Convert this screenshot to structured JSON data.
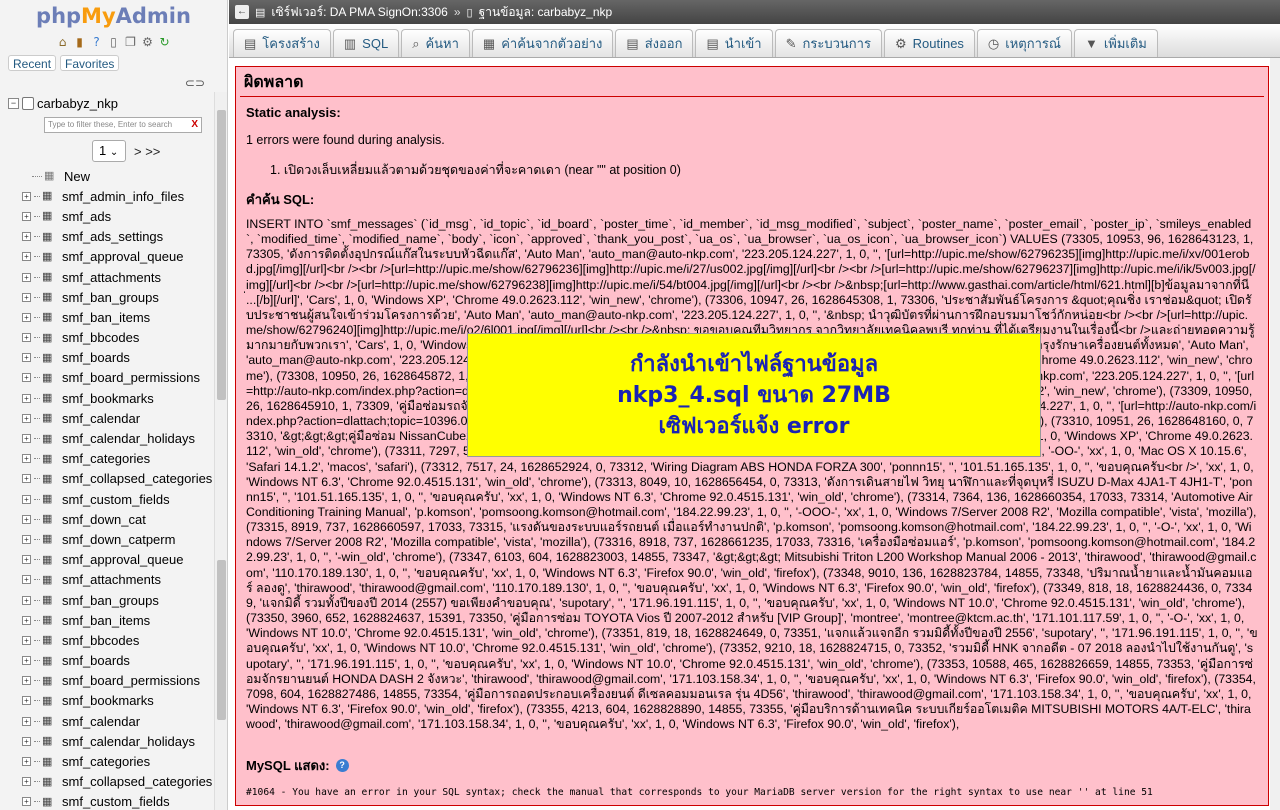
{
  "logo": {
    "part1": "php",
    "part2": "My",
    "part3": "Admin"
  },
  "quick_icons": [
    "home-icon",
    "exit-icon",
    "help-icon",
    "docs-icon",
    "copy-icon",
    "settings-icon",
    "reload-icon"
  ],
  "nav_tabs": {
    "recent": "Recent",
    "favorites": "Favorites"
  },
  "tree": {
    "database": "carbabyz_nkp",
    "filter_placeholder": "Type to filter these, Enter to search",
    "filter_clear": "X",
    "page_select_value": "1",
    "page_next": "> >>",
    "new_label": "New",
    "tables": [
      "smf_admin_info_files",
      "smf_ads",
      "smf_ads_settings",
      "smf_approval_queue",
      "smf_attachments",
      "smf_ban_groups",
      "smf_ban_items",
      "smf_bbcodes",
      "smf_boards",
      "smf_board_permissions",
      "smf_bookmarks",
      "smf_calendar",
      "smf_calendar_holidays",
      "smf_categories",
      "smf_collapsed_categories",
      "smf_custom_fields",
      "smf_down_cat",
      "smf_down_catperm",
      "smf_approval_queue",
      "smf_attachments",
      "smf_ban_groups",
      "smf_ban_items",
      "smf_bbcodes",
      "smf_boards",
      "smf_board_permissions",
      "smf_bookmarks",
      "smf_calendar",
      "smf_calendar_holidays",
      "smf_categories",
      "smf_collapsed_categories",
      "smf_custom_fields"
    ]
  },
  "breadcrumb": {
    "server": "เซิร์ฟเวอร์: DA PMA SignOn:3306",
    "separator": "»",
    "database": "ฐานข้อมูล: carbabyz_nkp"
  },
  "menu": [
    {
      "label": "โครงสร้าง",
      "icon": "structure-icon"
    },
    {
      "label": "SQL",
      "icon": "sql-icon"
    },
    {
      "label": "ค้นหา",
      "icon": "search-icon"
    },
    {
      "label": "ค่าค้นจากตัวอย่าง",
      "icon": "query-icon"
    },
    {
      "label": "ส่งออก",
      "icon": "export-icon"
    },
    {
      "label": "นำเข้า",
      "icon": "import-icon"
    },
    {
      "label": "กระบวนการ",
      "icon": "operations-icon"
    },
    {
      "label": "Routines",
      "icon": "routines-icon"
    },
    {
      "label": "เหตุการณ์",
      "icon": "events-icon"
    },
    {
      "label": "เพิ่มเติม",
      "icon": "more-icon"
    }
  ],
  "error": {
    "title": "ผิดพลาด",
    "static_analysis": "Static analysis:",
    "errors_found": "1 errors were found during analysis.",
    "error_item": "1. เปิดวงเล็บเหลี่ยมแล้วตามด้วยชุดของค่าที่จะคาดเดา (near \"\" at position 0)",
    "query_label": "คำค้น SQL:",
    "query_text": "INSERT INTO `smf_messages` (`id_msg`, `id_topic`, `id_board`, `poster_time`, `id_member`, `id_msg_modified`, `subject`, `poster_name`, `poster_email`, `poster_ip`, `smileys_enabled`, `modified_time`, `modified_name`, `body`, `icon`, `approved`, `thank_you_post`, `ua_os`, `ua_browser`, `ua_os_icon`, `ua_browser_icon`) VALUES (73305, 10953, 96, 1628643123, 1, 73305, 'ดังการติดตั้งอุปกรณ์แก๊สในระบบหัวฉีดแก๊ส', 'Auto Man', 'auto_man@auto-nkp.com', '223.205.124.227', 1, 0, '', '[url=http://upic.me/show/62796235][img]http://upic.me/i/xv/001erobd.jpg[/img][/url]<br /><br />[url=http://upic.me/show/62796236][img]http://upic.me/i/27/us002.jpg[/img][/url]<br /><br />[url=http://upic.me/show/62796237][img]http://upic.me/i/ik/5v003.jpg[/img][/url]<br /><br />[url=http://upic.me/show/62796238][img]http://upic.me/i/54/bt004.jpg[/img][/url]<br /><br />&nbsp;[url=http://www.gasthai.com/article/html/621.html][b]ข้อมูลมาจากที่นี่...[/b][/url]', 'Cars', 1, 0, 'Windows XP', 'Chrome 49.0.2623.112', 'win_new', 'chrome'), (73306, 10947, 26, 1628645308, 1, 73306, 'ประชาสัมพันธ์โครงการ &quot;คุณชิ่ง เราช่อม&quot; เปิดรับประชาชนผู้สนใจเข้าร่วมโครงการด้วย', 'Auto Man', 'auto_man@auto-nkp.com', '223.205.124.227', 1, 0, '', '&nbsp; นำวุฒิบัตรที่ผ่านการฝึกอบรมมาโชว์กักหน่อย<br /><br />[url=http://upic.me/show/62796240][img]http://upic.me/i/o2/6l001.jpg[/img][/url]<br /><br />&nbsp; ขอขอบคุณทีมวิทยากร จากวิทยาลัยเทคนิคลพบุรี ทุกท่าน ที่ได้เตรียมงานในเรื่องนี้<br />และถ่ายทอดความรู้มากมายกับพวกเรา', 'Cars', 1, 0, 'Windows XP', 'Chrome 49.0.2623.112', 'win_new', 'chrome'), (73307, 10950, 26, 1628645392, 1, 73307, 'วิธีการบำรุงรักษาเครื่องยนต์ทั้งหมด', 'Auto Man', 'auto_man@auto-nkp.com', '223.205.124.227', 1, 0, '', '[img]http://image.free.in.th/v/2013/ia/130827052030.jpg[/img]', 'Cars', 1, 0, 'Windows XP', 'Chrome 49.0.2623.112', 'win_new', 'chrome'), (73308, 10950, 26, 1628645872, 1, 73308, 'คู่มือซ่อมรถจักรยานยนต์เล่มใหม่ เป็นที่หมายปองของใครหลายๆคน', 'Auto Man', 'auto_man@auto-nkp.com', '223.205.124.227', 1, 0, '', '[url=http://auto-nkp.com/index.php?action=dlattach;topic=10390.0;attach=6551]ดาวน์โหลดที่นี่[/url]', 'Cars', 1, 0, 'Windows XP', 'Chrome 49.0.2623.112', 'win_new', 'chrome'), (73309, 10950, 26, 1628645910, 1, 73309, 'คู่มือซ่อมรถจักรยานยนต์เล่มใหม่ เป็นที่หมายปองของใครหลายๆคน', 'Auto Man', 'auto_man@auto-nkp.com', '223.205.124.227', 1, 0, '', '[url=http://auto-nkp.com/index.php?action=dlattach;topic=10396.0;attach=6557]ดาวน์โหลดที่นี่[/url]', 'Cars', 1, 0, 'Windows XP', 'Chrome 49.0.2623.112', 'win_new', 'chrome'), (73310, 10951, 26, 1628648160, 0, 73310, '&gt;&gt;&gt;คู่มือซ่อม NissanCube2009', 'Auto Man', 'auto_man@auto-nkp.com', '223.205.124.227', 1, 0, '', 'ดาวน์โหลดคู่มือซ่อมได้ที่นี่', 'xx', 1, 0, 'Windows XP', 'Chrome 49.0.2623.112', 'win_old', 'chrome'), (73311, 7297, 587, 1628648170, 0, 73311, 'Datsun 620 Series 1977 Service Manual', 'Browser', '', '171.5.227.150', 1, 0, '', '-OO-', 'xx', 1, 0, 'Mac OS X 10.15.6', 'Safari 14.1.2', 'macos', 'safari'), (73312, 7517, 24, 1628652924, 0, 73312, 'Wiring Diagram ABS HONDA FORZA 300', 'ponnn15', '', '101.51.165.135', 1, 0, '', 'ขอบคุณครับ<br />', 'xx', 1, 0, 'Windows NT 6.3', 'Chrome 92.0.4515.131', 'win_old', 'chrome'), (73313, 8049, 10, 1628656454, 0, 73313, 'ดังการเดินสายไฟ วิทยุ นาฬิกาและที่จุดบุหรี่ ISUZU D-Max 4JA1-T 4JH1-T', 'ponnn15', '', '101.51.165.135', 1, 0, '', 'ขอบคุณครับ', 'xx', 1, 0, 'Windows NT 6.3', 'Chrome 92.0.4515.131', 'win_old', 'chrome'), (73314, 7364, 136, 1628660354, 17033, 73314, 'Automotive Air Conditioning Training Manual', 'p.komson', 'pomsoong.komson@hotmail.com', '184.22.99.23', 1, 0, '', '-OOO-', 'xx', 1, 0, 'Windows 7/Server 2008 R2', 'Mozilla compatible', 'vista', 'mozilla'), (73315, 8919, 737, 1628660597, 17033, 73315, 'แรงดันของระบบแอร์รถยนต์ เมื่อแอร์ทำงานปกติ', 'p.komson', 'pomsoong.komson@hotmail.com', '184.22.99.23', 1, 0, '', '-O-', 'xx', 1, 0, 'Windows 7/Server 2008 R2', 'Mozilla compatible', 'vista', 'mozilla'), (73316, 8918, 737, 1628661235, 17033, 73316, 'เครื่องมือซ่อมแอร์', 'p.komson', 'pomsoong.komson@hotmail.com', '184.22.99.23', 1, 0, '', '-win_old', 'chrome'), (73347, 6103, 604, 1628823003, 14855, 73347, '&gt;&gt;&gt; Mitsubishi Triton L200 Workshop Manual 2006 - 2013', 'thirawood', 'thirawood@gmail.com', '110.170.189.130', 1, 0, '', 'ขอบคุณครับ', 'xx', 1, 0, 'Windows NT 6.3', 'Firefox 90.0', 'win_old', 'firefox'), (73348, 9010, 136, 1628823784, 14855, 73348, 'ปริมาณน้ำยาและน้ำมันคอมแอร์ ลองดู', 'thirawood', 'thirawood@gmail.com', '110.170.189.130', 1, 0, '', 'ขอบคุณครับ', 'xx', 1, 0, 'Windows NT 6.3', 'Firefox 90.0', 'win_old', 'firefox'), (73349, 818, 18, 1628824436, 0, 73349, 'แจกมิดี้ รวมทั้งปีของปี 2014 (2557) ขอเพียงคำขอบคุณ', 'supotary', '', '171.96.191.115', 1, 0, '', 'ขอบคุณครับ', 'xx', 1, 0, 'Windows NT 10.0', 'Chrome 92.0.4515.131', 'win_old', 'chrome'), (73350, 3960, 652, 1628824637, 15391, 73350, 'คู่มือการซ่อม TOYOTA Vios ปี 2007-2012 สำหรับ [VIP Group]', 'montree', 'montree@ktcm.ac.th', '171.101.117.59', 1, 0, '', '-O-', 'xx', 1, 0, 'Windows NT 10.0', 'Chrome 92.0.4515.131', 'win_old', 'chrome'), (73351, 819, 18, 1628824649, 0, 73351, 'แจกแล้วแจกอีก รวมมิดี้ทั้งปีของปี 2556', 'supotary', '', '171.96.191.115', 1, 0, '', 'ขอบคุณครับ', 'xx', 1, 0, 'Windows NT 10.0', 'Chrome 92.0.4515.131', 'win_old', 'chrome'), (73352, 9210, 18, 1628824715, 0, 73352, 'รวมมิดี้ HNK จากอดีต - 07 2018 ลองนำไปใช้งานกันดู', 'supotary', '', '171.96.191.115', 1, 0, '', 'ขอบคุณครับ', 'xx', 1, 0, 'Windows NT 10.0', 'Chrome 92.0.4515.131', 'win_old', 'chrome'), (73353, 10588, 465, 1628826659, 14855, 73353, 'คู่มือการซ่อมจักรยานยนต์ HONDA DASH 2 จังหวะ', 'thirawood', 'thirawood@gmail.com', '171.103.158.34', 1, 0, '', 'ขอบคุณครับ', 'xx', 1, 0, 'Windows NT 6.3', 'Firefox 90.0', 'win_old', 'firefox'), (73354, 7098, 604, 1628827486, 14855, 73354, 'คู่มือการถอดประกอบเครื่องยนต์ ดีเซลคอมมอนเรล รุ่น 4D56', 'thirawood', 'thirawood@gmail.com', '171.103.158.34', 1, 0, '', 'ขอบคุณครับ', 'xx', 1, 0, 'Windows NT 6.3', 'Firefox 90.0', 'win_old', 'firefox'), (73355, 4213, 604, 1628828890, 14855, 73355, 'คู่มือบริการด้านเทคนิค ระบบเกียร์ออโตเมติค MITSUBISHI MOTORS 4A/T-ELC', 'thirawood', 'thirawood@gmail.com', '171.103.158.34', 1, 0, '', 'ขอบคุณครับ', 'xx', 1, 0, 'Windows NT 6.3', 'Firefox 90.0', 'win_old', 'firefox'),",
    "mysql_says_label": "MySQL แสดง:",
    "mysql_error": "#1064 - You have an error in your SQL syntax; check the manual that corresponds to your MariaDB server version for the right syntax to use near '' at line 51"
  },
  "overlay": {
    "line1": "กำลังนำเข้าไฟล์ฐานข้อมูล",
    "line2": "nkp3_4.sql ขนาด 27MB",
    "line3": "เซิฟเวอร์แจ้ง error"
  },
  "colors": {
    "error_bg": "#ffc0cb",
    "overlay_bg": "#ffff00",
    "overlay_text": "#1a23b4",
    "link": "#235a81"
  }
}
